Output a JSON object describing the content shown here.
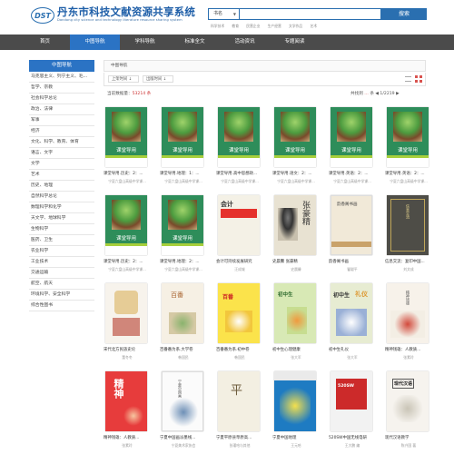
{
  "header": {
    "logo_mark": "DST",
    "site_title": "丹东市科技文献资源共享系统",
    "site_subtitle": "Dandong city science and technology literature resource sharing system",
    "search_field": "书名",
    "search_button": "搜索",
    "hot_words": [
      "科学技术",
      "教育",
      "民营企业",
      "生产经营",
      "文学作品",
      "艺术"
    ]
  },
  "nav": [
    "首页",
    "中图导航",
    "学科导航",
    "标准全文",
    "活动资讯",
    "专题阅读"
  ],
  "nav_active": 1,
  "sidebar": {
    "title": "中图导航",
    "items": [
      "马克思主义、列宁主义、毛...",
      "哲学、宗教",
      "社会科学总论",
      "政治、法律",
      "军事",
      "经济",
      "文化、科学、教育、体育",
      "语言、文字",
      "文学",
      "艺术",
      "历史、地理",
      "自然科学总论",
      "数理科学和化学",
      "天文学、地球科学",
      "生物科学",
      "医药、卫生",
      "农业科学",
      "工业技术",
      "交通运输",
      "航空、航天",
      "环境科学、安全科学",
      "综合性图书"
    ]
  },
  "breadcrumb": "中图导航",
  "sort": {
    "option1": "上架时间",
    "option2": "出版时间"
  },
  "results": {
    "label": "当前数据量：",
    "count": "53214 条"
  },
  "pager": {
    "prefix": "共找到",
    "sep": "条",
    "page": "1/2219",
    "prev": "◀",
    "next": "▶"
  },
  "books": [
    {
      "title": "课堂导用.历史：2：...",
      "author": "宁夏六盘山高级中学课..."
    },
    {
      "title": "课堂导用.地理：1：...",
      "author": "宁夏六盘山高级中学课..."
    },
    {
      "title": "课堂导用.高中思想政...",
      "author": "宁夏六盘山高级中学课..."
    },
    {
      "title": "课堂导用.语文：2：...",
      "author": "宁夏六盘山高级中学课..."
    },
    {
      "title": "课堂导用.英语：2：...",
      "author": "宁夏六盘山高级中学课..."
    },
    {
      "title": "课堂导用.英语：2：...",
      "author": "宁夏六盘山高级中学课..."
    },
    {
      "title": "课堂导用.历史：2：...",
      "author": "宁夏六盘山高级中学课..."
    },
    {
      "title": "课堂导用.地理：2：...",
      "author": "宁夏六盘山高级中学课..."
    },
    {
      "title": "会计可持续发展研究",
      "author": "汪成城"
    },
    {
      "title": "史晨馨 张豪精",
      "author": "史晨馨"
    },
    {
      "title": "韵香阁书画",
      "author": "瞿聪平"
    },
    {
      "title": "信息交流：复印中国...",
      "author": "刘文成"
    },
    {
      "title": "宋代北方民族史论",
      "author": "董冬冬"
    },
    {
      "title": "百番番为系.大学卷",
      "author": "韩国民"
    },
    {
      "title": "百番番为系.初中卷",
      "author": "韩国民"
    },
    {
      "title": "初中生心理健康",
      "author": "张大军"
    },
    {
      "title": "初中生礼仪",
      "author": "张大军"
    },
    {
      "title": "精神钱雄：人教质...",
      "author": "张素玲"
    },
    {
      "title": "精神钱雄：人教质...",
      "author": "张素玲"
    },
    {
      "title": "宁夏中国画派墨线...",
      "author": "宁夏美术家协会"
    },
    {
      "title": "宁夏平原县草原高...",
      "author": "张瑾哈与其他"
    },
    {
      "title": "宁夏中国地理",
      "author": "王元哈"
    },
    {
      "title": "520SW中国无线电研",
      "author": "王大鹏 编"
    },
    {
      "title": "现代汉语教学",
      "author": "陈兴国 著"
    }
  ],
  "book_label": "课堂导用"
}
